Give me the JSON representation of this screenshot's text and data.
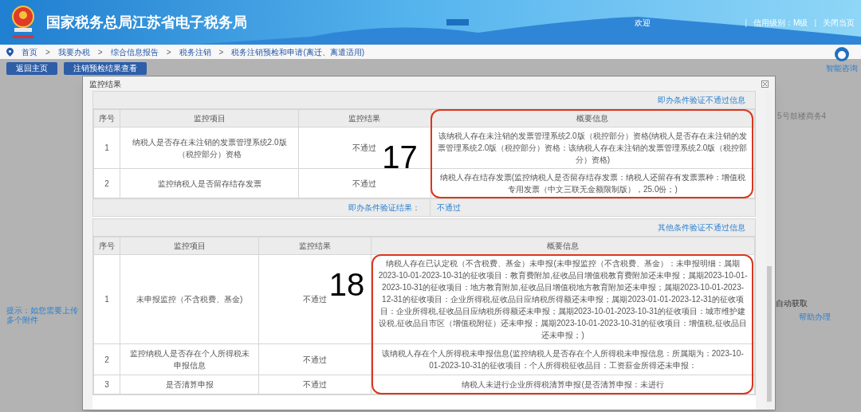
{
  "header": {
    "title": "国家税务总局江苏省电子税务局",
    "welcome": "欢迎",
    "credit": "信用级别：M级",
    "close": "关闭当页",
    "divider": "|"
  },
  "breadcrumb": {
    "separator": ">",
    "items": [
      "首页",
      "我要办税",
      "综合信息报告",
      "税务注销",
      "税务注销预检和申请(离迁、离遣适用)"
    ]
  },
  "buttons": [
    "返回主页",
    "注销预检结果查看"
  ],
  "assistant": "智能咨询",
  "background": {
    "address": "5号鼓楼商务4",
    "tip": "提示：如您需要上传多个附件",
    "auto": "自动获取",
    "help": "帮助办理"
  },
  "modal": {
    "title": "监控结果",
    "sections": [
      {
        "caption": "即办条件验证不通过信息",
        "columns": [
          "序号",
          "监控项目",
          "监控结果",
          "概要信息"
        ],
        "annotation": "17",
        "highlight_header": true,
        "rows": [
          {
            "no": "1",
            "item": "纳税人是否存在未注销的发票管理系统2.0版（税控部分）资格",
            "result": "不通过",
            "summary": "该纳税人存在未注销的发票管理系统2.0版（税控部分）资格(纳税人是否存在未注销的发票管理系统2.0版（税控部分）资格：该纳税人存在未注销的发票管理系统2.0版（税控部分）资格)"
          },
          {
            "no": "2",
            "item": "监控纳税人是否留存结存发票",
            "result": "不通过",
            "summary": "纳税人存在结存发票(监控纳税人是否留存结存发票：纳税人还留存有发票票种：增值税专用发票（中文三联无金额限制版），25.0份；)"
          }
        ],
        "footer": {
          "label": "即办条件验证结果：",
          "value": "不通过"
        }
      },
      {
        "caption": "其他条件验证不通过信息",
        "columns": [
          "序号",
          "监控项目",
          "监控结果",
          "概要信息"
        ],
        "annotation": "18",
        "highlight_header": false,
        "rows": [
          {
            "no": "1",
            "item": "未申报监控（不含税费、基金)",
            "result": "不通过",
            "summary": "纳税人存在已认定税（不含税费、基金）未申报(未申报监控（不含税费、基金）：未申报明细：属期2023-10-01-2023-10-31的征收项目：教育费附加,征收品目增值税教育费附加还未申报；属期2023-10-01-2023-10-31的征收项目：地方教育附加,征收品目增值税地方教育附加还未申报；属期2023-10-01-2023-12-31的征收项目：企业所得税,征收品目应纳税所得额还未申报；属期2023-01-01-2023-12-31的征收项目：企业所得税,征收品目应纳税所得额还未申报；属期2023-10-01-2023-10-31的征收项目：城市维护建设税,征收品目市区（增值税附征）还未申报；属期2023-10-01-2023-10-31的征收项目：增值税,征收品目还未申报；)"
          },
          {
            "no": "2",
            "item": "监控纳税人是否存在个人所得税未申报信息",
            "result": "不通过",
            "summary": "该纳税人存在个人所得税未申报信息(监控纳税人是否存在个人所得税未申报信息：所属期为：2023-10-01-2023-10-31的征收项目：个人所得税征收品目：工资薪金所得还未申报："
          },
          {
            "no": "3",
            "item": "是否清算申报",
            "result": "不通过",
            "summary": "纳税人未进行企业所得税清算申报(是否清算申报：未进行"
          }
        ]
      }
    ]
  }
}
